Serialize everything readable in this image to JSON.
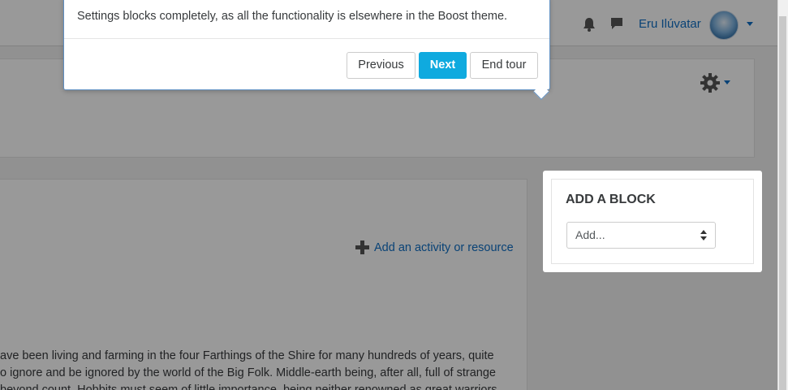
{
  "navbar": {
    "notifications_icon": "bell-icon",
    "messages_icon": "message-icon",
    "username": "Eru Ilúvatar",
    "avatar_icon": "user-avatar"
  },
  "header": {
    "settings_icon": "gear-icon"
  },
  "main": {
    "add_activity_label": "Add an activity or resource",
    "paragraph_lines": [
      "ave been living and farming in the four Farthings of the Shire for many hundreds of years, quite",
      "o ignore and be ignored by the world of the Big Folk. Middle-earth being, after all, full of strange",
      "beyond count. Hobbits must seem of little importance, being neither renowned as great warriors"
    ]
  },
  "add_block": {
    "title": "ADD A BLOCK",
    "select_value": "Add..."
  },
  "tour": {
    "text": "Settings blocks completely, as all the functionality is elsewhere in the Boost theme.",
    "previous_label": "Previous",
    "next_label": "Next",
    "end_label": "End tour"
  },
  "colors": {
    "link": "#0f6fc5",
    "primary_button": "#0faadf",
    "popover_border": "#5f8fc2"
  }
}
